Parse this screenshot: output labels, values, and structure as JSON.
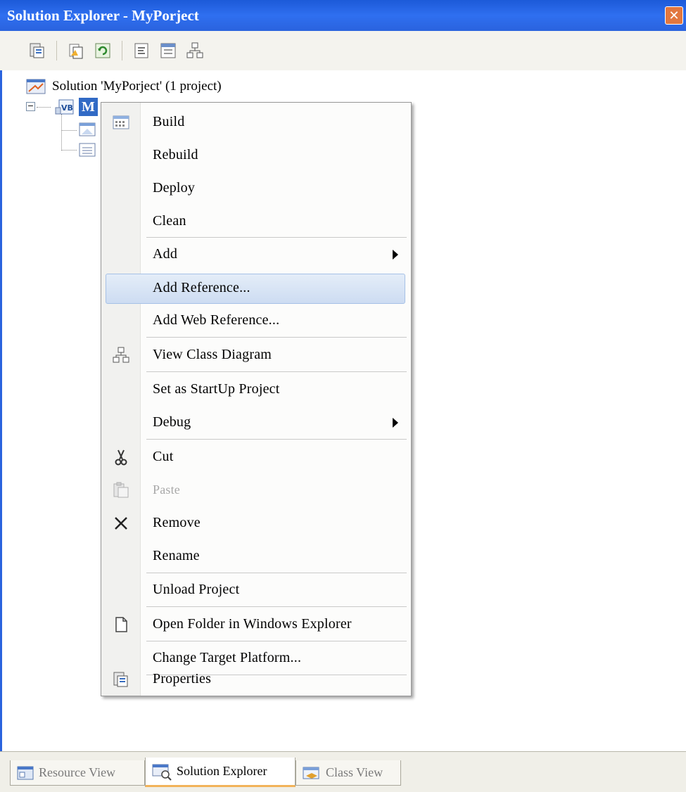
{
  "window": {
    "title": "Solution Explorer - MyPorject",
    "close_glyph": "✕"
  },
  "toolbar": {
    "buttons": [
      {
        "name": "properties-icon"
      },
      {
        "name": "show-all-files-icon"
      },
      {
        "name": "refresh-icon"
      },
      {
        "name": "view-code-icon"
      },
      {
        "name": "view-designer-icon"
      },
      {
        "name": "view-class-diagram-icon"
      }
    ]
  },
  "tree": {
    "solution_label": "Solution 'MyPorject' (1 project)",
    "project_label": "M",
    "expander_glyph": "−"
  },
  "context_menu": {
    "items": [
      {
        "label": "Build",
        "icon": "build-icon"
      },
      {
        "label": "Rebuild"
      },
      {
        "label": "Deploy"
      },
      {
        "label": "Clean"
      },
      {
        "label": "Add",
        "submenu": true
      },
      {
        "label": "Add Reference...",
        "highlighted": true
      },
      {
        "label": "Add Web Reference..."
      },
      {
        "label": "View Class Diagram",
        "icon": "class-diagram-icon"
      },
      {
        "label": "Set as StartUp Project"
      },
      {
        "label": "Debug",
        "submenu": true
      },
      {
        "label": "Cut",
        "icon": "scissors-icon"
      },
      {
        "label": "Paste",
        "icon": "paste-icon",
        "disabled": true
      },
      {
        "label": "Remove",
        "icon": "delete-x-icon"
      },
      {
        "label": "Rename"
      },
      {
        "label": "Unload Project"
      },
      {
        "label": "Open Folder in Windows Explorer",
        "icon": "open-folder-icon"
      },
      {
        "label": "Change Target Platform..."
      },
      {
        "label": "Properties",
        "icon": "properties-icon"
      }
    ]
  },
  "bottom_tabs": [
    {
      "label": "Resource View",
      "active": false
    },
    {
      "label": "Solution Explorer",
      "active": true
    },
    {
      "label": "Class View",
      "active": false
    }
  ],
  "colors": {
    "title_bar": "#2a63de",
    "selection": "#316ac5",
    "menu_highlight": "#cddcf2"
  }
}
